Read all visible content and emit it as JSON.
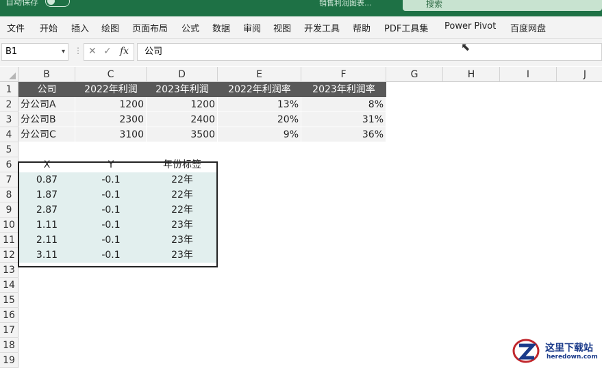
{
  "titlebar": {
    "autosave_label": "自动保存",
    "doc_title": "销售利润图表...",
    "search_placeholder": "搜索"
  },
  "menu": [
    "文件",
    "开始",
    "插入",
    "绘图",
    "页面布局",
    "公式",
    "数据",
    "审阅",
    "视图",
    "开发工具",
    "帮助",
    "PDF工具集",
    "Power Pivot",
    "百度网盘"
  ],
  "namebox": "B1",
  "formula_value": "公司",
  "columns": [
    "B",
    "C",
    "D",
    "E",
    "F",
    "G",
    "H",
    "I",
    "J"
  ],
  "rows": [
    "1",
    "2",
    "3",
    "4",
    "5",
    "6",
    "7",
    "8",
    "9",
    "10",
    "11",
    "12",
    "13",
    "14",
    "15",
    "16",
    "17",
    "18",
    "19"
  ],
  "table1": {
    "headers": [
      "公司",
      "2022年利润",
      "2023年利润",
      "2022年利润率",
      "2023年利润率"
    ],
    "rows": [
      [
        "分公司A",
        "1200",
        "1200",
        "13%",
        "8%"
      ],
      [
        "分公司B",
        "2300",
        "2400",
        "20%",
        "31%"
      ],
      [
        "分公司C",
        "3100",
        "3500",
        "9%",
        "36%"
      ]
    ]
  },
  "table2": {
    "headers": [
      "X",
      "Y",
      "年份标签"
    ],
    "rows": [
      [
        "0.87",
        "-0.1",
        "22年"
      ],
      [
        "1.87",
        "-0.1",
        "22年"
      ],
      [
        "2.87",
        "-0.1",
        "22年"
      ],
      [
        "1.11",
        "-0.1",
        "23年"
      ],
      [
        "2.11",
        "-0.1",
        "23年"
      ],
      [
        "3.11",
        "-0.1",
        "23年"
      ]
    ]
  },
  "watermark": {
    "name": "这里下载站",
    "url": "heredown.com"
  }
}
